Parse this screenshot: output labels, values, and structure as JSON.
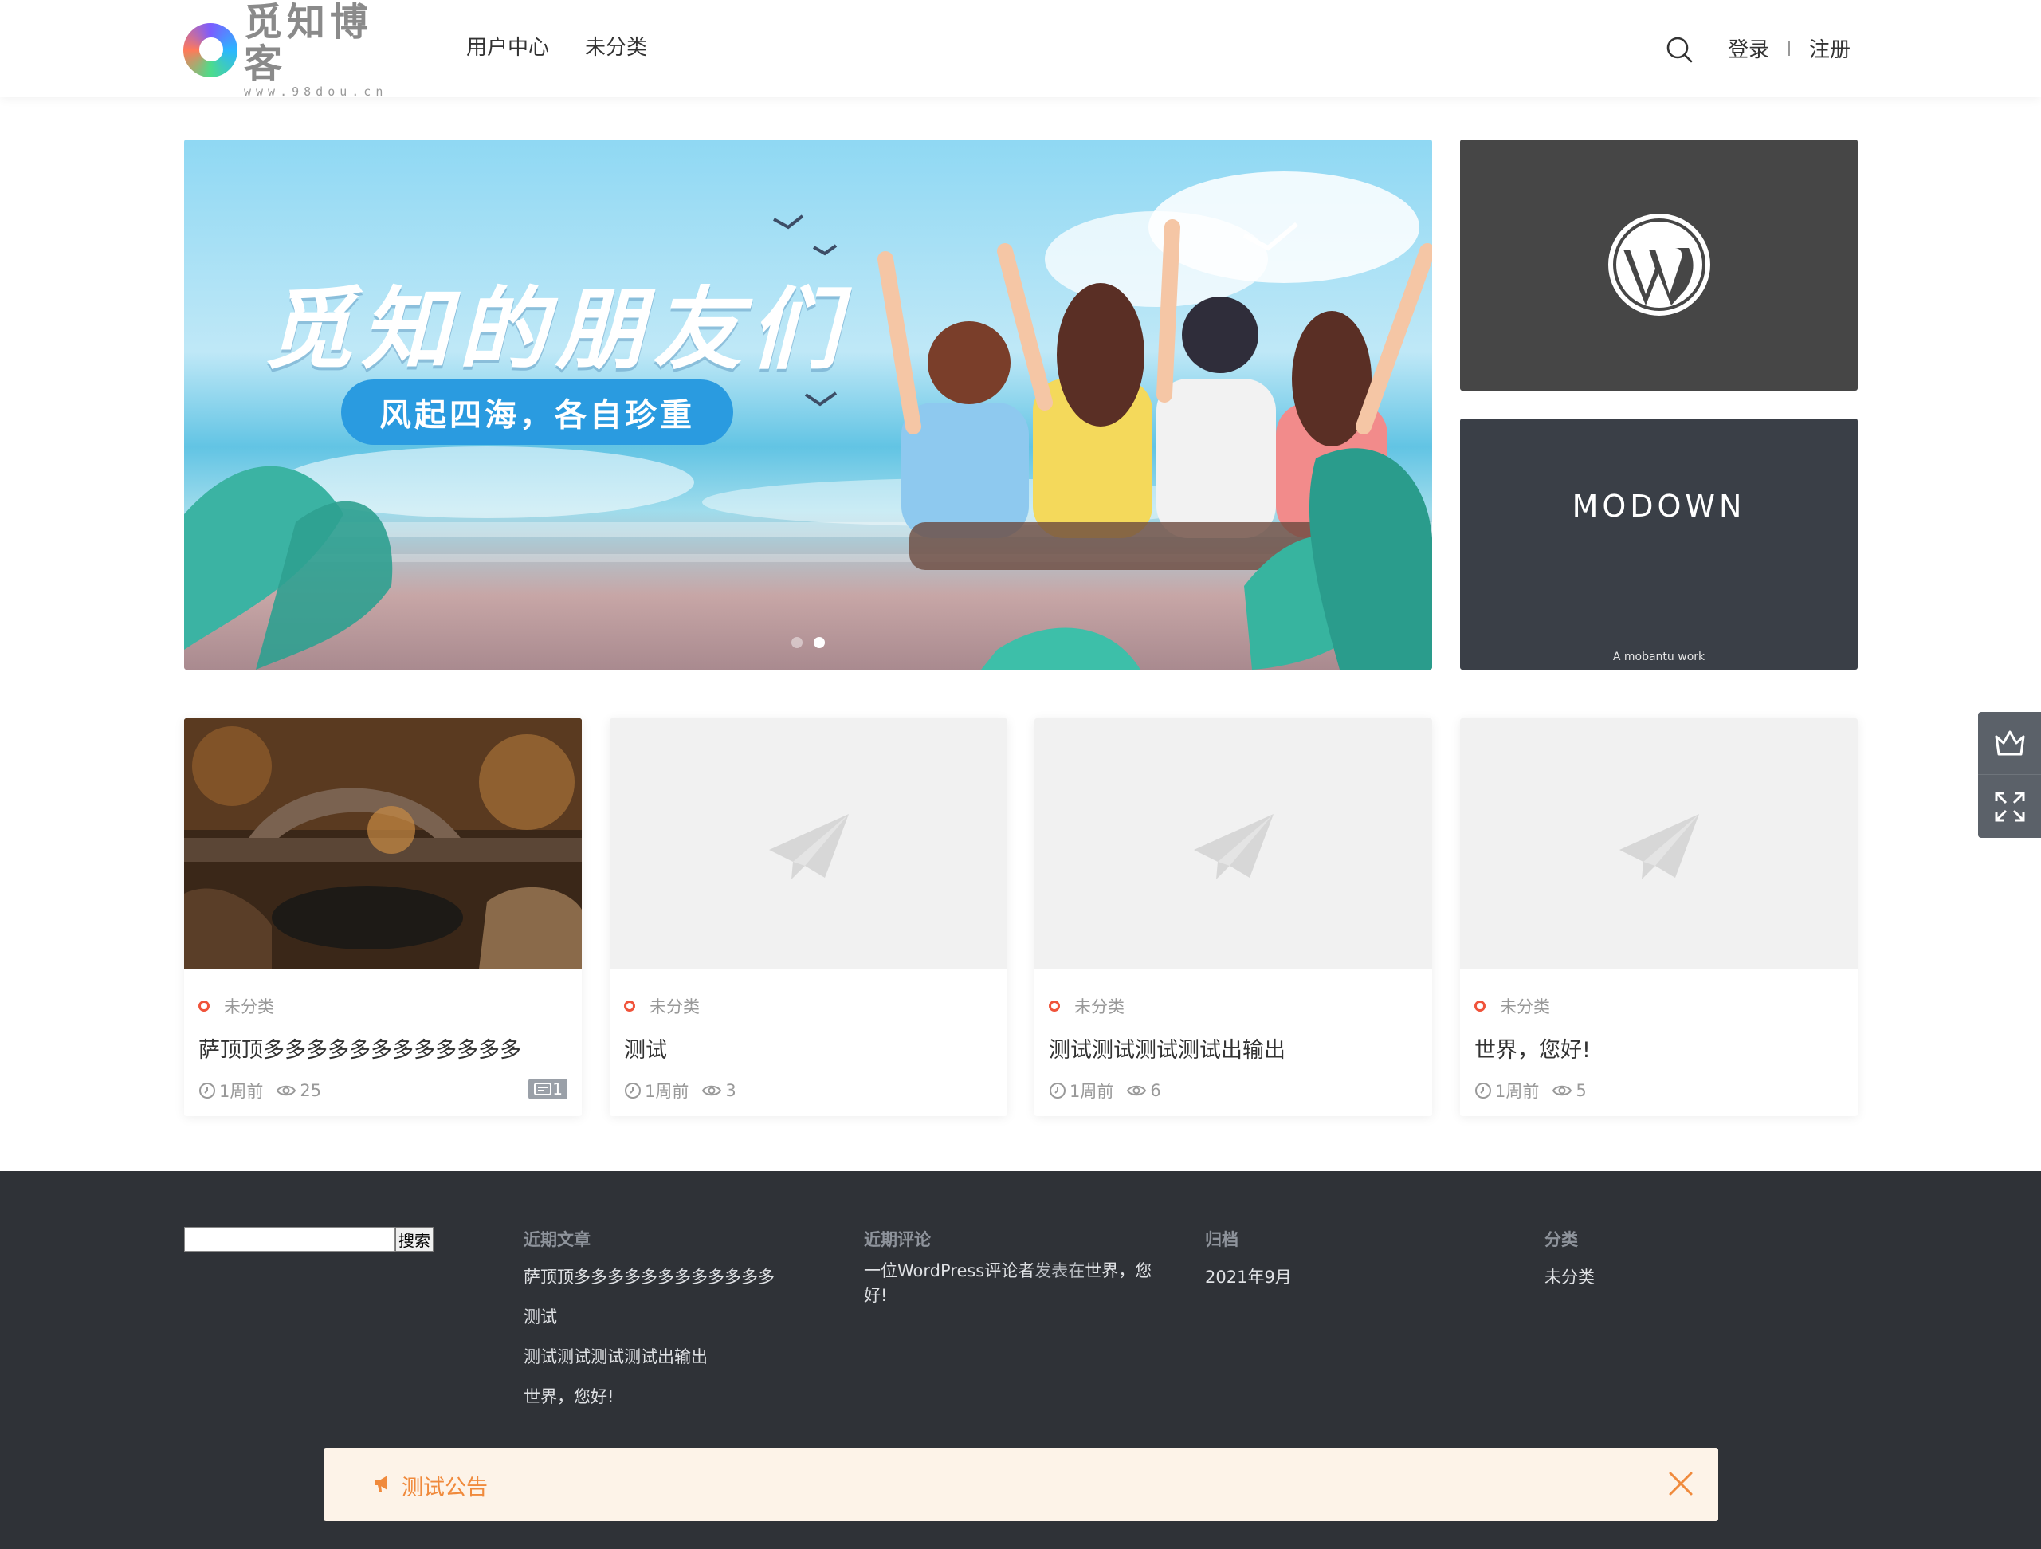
{
  "header": {
    "logo_title": "觅知博客",
    "logo_sub": "www.98dou.cn",
    "nav": [
      {
        "label": "用户中心"
      },
      {
        "label": "未分类"
      }
    ],
    "login_label": "登录",
    "register_label": "注册"
  },
  "hero": {
    "title": "觅知的朋友们",
    "subtitle": "风起四海，各自珍重",
    "slide_count": 2,
    "active_slide": 2
  },
  "side_cards": {
    "modown_title": "MODOWN",
    "modown_sub": "A mobantu work"
  },
  "posts": [
    {
      "category": "未分类",
      "title": "萨顶顶多多多多多多多多多多多多",
      "time": "1周前",
      "views": "25",
      "comments": "1",
      "has_image": true
    },
    {
      "category": "未分类",
      "title": "测试",
      "time": "1周前",
      "views": "3",
      "has_image": false
    },
    {
      "category": "未分类",
      "title": "测试测试测试测试出输出",
      "time": "1周前",
      "views": "6",
      "has_image": false
    },
    {
      "category": "未分类",
      "title": "世界，您好!",
      "time": "1周前",
      "views": "5",
      "has_image": false
    }
  ],
  "footer": {
    "search_value": "",
    "search_button": "搜索",
    "recent_posts_title": "近期文章",
    "recent_posts": [
      "萨顶顶多多多多多多多多多多多多",
      "测试",
      "测试测试测试测试出输出",
      "世界，您好!"
    ],
    "recent_comments_title": "近期评论",
    "comment_author": "一位WordPress评论者",
    "comment_on": "发表在",
    "comment_post": "世界，您好!",
    "archives_title": "归档",
    "archives": [
      "2021年9月"
    ],
    "categories_title": "分类",
    "categories": [
      "未分类"
    ]
  },
  "notice": {
    "text": "测试公告"
  },
  "colors": {
    "accent": "#f0533a",
    "footer_bg": "#2f3237",
    "notice_bg": "#fdf3e8",
    "notice_text": "#f08a3c"
  },
  "icons": [
    "search-icon",
    "wordpress-logo-icon",
    "crown-icon",
    "fullscreen-icon",
    "clock-icon",
    "eye-icon",
    "comment-icon",
    "megaphone-icon",
    "close-icon",
    "paper-plane-icon"
  ]
}
